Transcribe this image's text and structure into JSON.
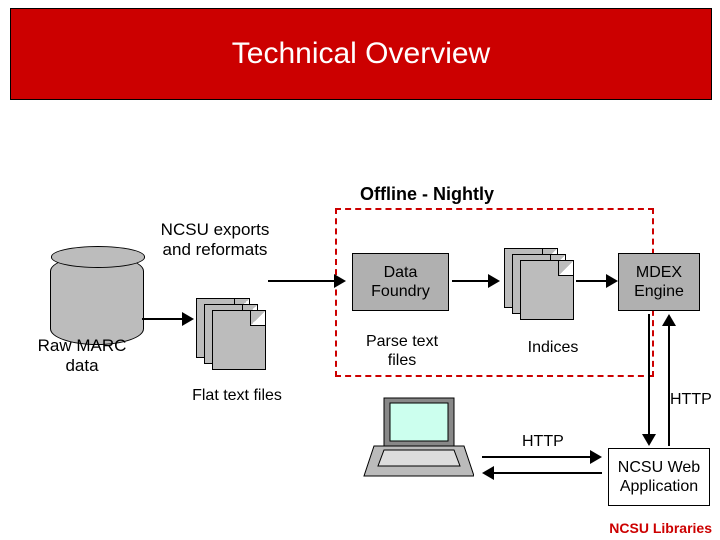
{
  "title": "Technical Overview",
  "section_label": "Offline - Nightly",
  "cyl1_label": "NCSU exports and reformats",
  "cyl1_caption": "Raw MARC data",
  "flatfiles_caption": "Flat text files",
  "foundry_label": "Data Foundry",
  "foundry_caption": "Parse text files",
  "indices_caption": "Indices",
  "mdex_label": "MDEX Engine",
  "http_label_top": "HTTP",
  "http_label_left": "HTTP",
  "webapp_label": "NCSU Web Application",
  "footer": "NCSU Libraries"
}
